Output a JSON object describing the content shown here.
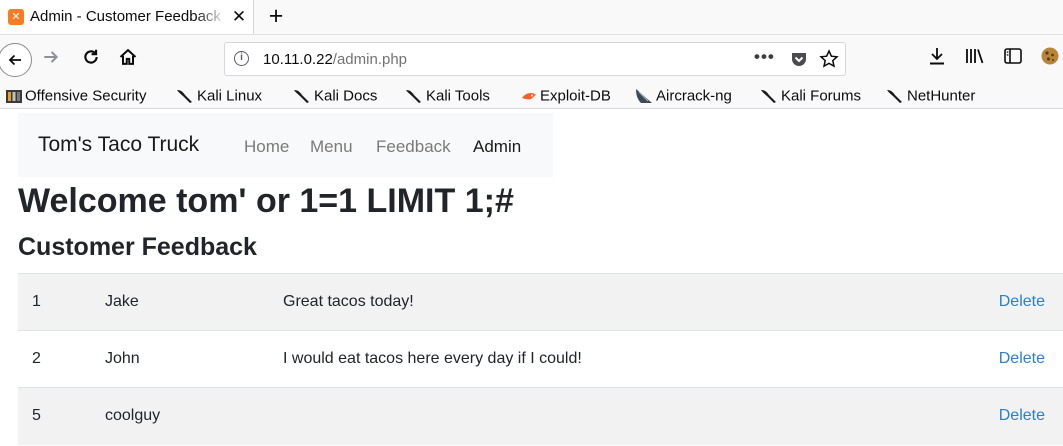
{
  "browser": {
    "tab": {
      "favicon": "xampp-favicon",
      "title": "Admin - Customer Feedback"
    },
    "url": {
      "host": "10.11.0.22",
      "path": "/admin.php"
    },
    "page_actions": "•••",
    "bookmarks": [
      {
        "label": "Offensive Security",
        "icon": "offsec-icon"
      },
      {
        "label": "Kali Linux",
        "icon": "kali-dragon-icon"
      },
      {
        "label": "Kali Docs",
        "icon": "kali-dragon-icon"
      },
      {
        "label": "Kali Tools",
        "icon": "kali-dragon-icon"
      },
      {
        "label": "Exploit-DB",
        "icon": "exploitdb-icon"
      },
      {
        "label": "Aircrack-ng",
        "icon": "aircrack-icon"
      },
      {
        "label": "Kali Forums",
        "icon": "kali-dragon-icon"
      },
      {
        "label": "NetHunter",
        "icon": "kali-dragon-icon"
      }
    ]
  },
  "site": {
    "brand": "Tom's Taco Truck",
    "nav": [
      {
        "label": "Home"
      },
      {
        "label": "Menu"
      },
      {
        "label": "Feedback"
      },
      {
        "label": "Admin",
        "active": true
      }
    ]
  },
  "page": {
    "welcome": "Welcome tom' or 1=1 LIMIT 1;#",
    "subheading": "Customer Feedback",
    "rows": [
      {
        "id": "1",
        "name": "Jake",
        "message": "Great tacos today!",
        "action": "Delete"
      },
      {
        "id": "2",
        "name": "John",
        "message": "I would eat tacos here every day if I could!",
        "action": "Delete"
      },
      {
        "id": "5",
        "name": "coolguy",
        "message": "",
        "action": "Delete"
      }
    ]
  },
  "colors": {
    "link": "#2a7fd4",
    "stripe": "#f2f2f2",
    "nav_bg": "#f8f9fa"
  }
}
